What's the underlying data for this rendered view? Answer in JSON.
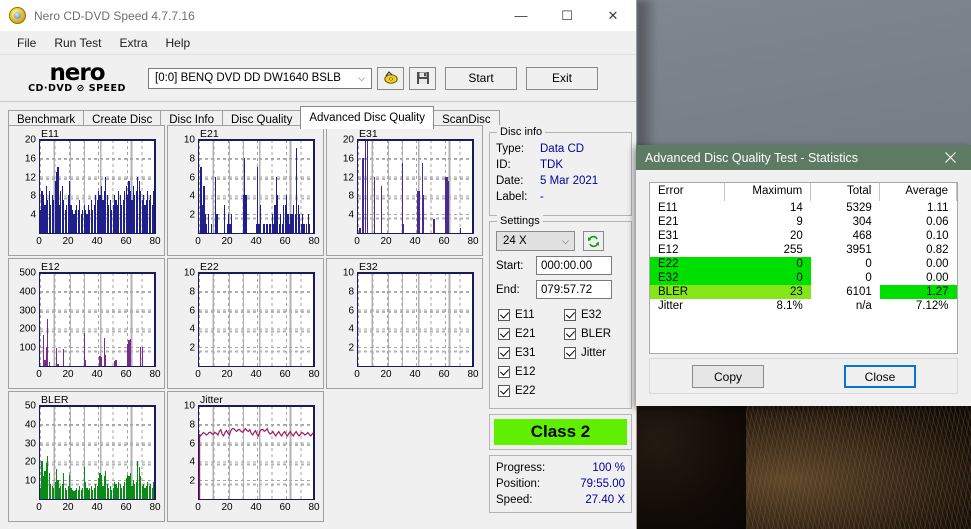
{
  "window": {
    "title": "Nero CD-DVD Speed 4.7.7.16",
    "icon": "nero-disc-icon",
    "controls": {
      "minimize": "—",
      "maximize": "☐",
      "close": "✕"
    }
  },
  "menu": {
    "items": [
      "File",
      "Run Test",
      "Extra",
      "Help"
    ]
  },
  "toolbar": {
    "logo_primary": "nero",
    "logo_secondary": "CD·DVD ⊘ SPEED",
    "drive_value": "[0:0]   BENQ DVD DD DW1640 BSLB",
    "drive_chevron": "⌵",
    "eject_icon": "disc-eject-icon",
    "save_icon": "floppy-save-icon",
    "start_label": "Start",
    "exit_label": "Exit"
  },
  "tabs": {
    "items": [
      "Benchmark",
      "Create Disc",
      "Disc Info",
      "Disc Quality",
      "Advanced Disc Quality",
      "ScanDisc"
    ],
    "active": "Advanced Disc Quality"
  },
  "disc_info": {
    "legend": "Disc info",
    "rows": [
      {
        "key": "Type:",
        "value": "Data CD"
      },
      {
        "key": "ID:",
        "value": "TDK"
      },
      {
        "key": "Date:",
        "value": "5 Mar 2021"
      },
      {
        "key": "Label:",
        "value": "-"
      }
    ]
  },
  "settings": {
    "legend": "Settings",
    "speed_value": "24 X",
    "speed_chevron": "⌵",
    "refresh_icon": "refresh-icon",
    "start_label": "Start:",
    "start_value": "000:00.00",
    "end_label": "End:",
    "end_value": "079:57.72",
    "checkboxes_left": [
      "E11",
      "E21",
      "E31",
      "E12",
      "E22"
    ],
    "checkboxes_right": [
      "E32",
      "BLER",
      "Jitter"
    ]
  },
  "class_badge": {
    "label": "Class 2",
    "color": "#5ef000"
  },
  "status": {
    "rows": [
      {
        "key": "Progress:",
        "value": "100 %"
      },
      {
        "key": "Position:",
        "value": "79:55.00"
      },
      {
        "key": "Speed:",
        "value": "27.40 X"
      }
    ]
  },
  "dialog": {
    "title": "Advanced Disc Quality Test - Statistics",
    "close_icon": "close-icon",
    "title_color": "#5d7a63",
    "headers": [
      "Error",
      "Maximum",
      "Total",
      "Average"
    ],
    "rows": [
      {
        "error": "E11",
        "maximum": "14",
        "total": "5329",
        "average": "1.11",
        "highlight": "none"
      },
      {
        "error": "E21",
        "maximum": "9",
        "total": "304",
        "average": "0.06",
        "highlight": "none"
      },
      {
        "error": "E31",
        "maximum": "20",
        "total": "468",
        "average": "0.10",
        "highlight": "none"
      },
      {
        "error": "E12",
        "maximum": "255",
        "total": "3951",
        "average": "0.82",
        "highlight": "none"
      },
      {
        "error": "E22",
        "maximum": "0",
        "total": "0",
        "average": "0.00",
        "highlight": "green-left"
      },
      {
        "error": "E32",
        "maximum": "0",
        "total": "0",
        "average": "0.00",
        "highlight": "green-left"
      },
      {
        "error": "BLER",
        "maximum": "23",
        "total": "6101",
        "average": "1.27",
        "highlight": "yellowgreen-left-green-avg"
      },
      {
        "error": "Jitter",
        "maximum": "8.1%",
        "total": "n/a",
        "average": "7.12%",
        "highlight": "none"
      }
    ],
    "highlight_colors": {
      "green": "#00e000",
      "yellow_green": "#84e619"
    },
    "copy_label": "Copy",
    "close_label": "Close"
  },
  "chart_data": [
    {
      "type": "bar",
      "title": "E11",
      "xlabel": "",
      "ylabel": "",
      "xlim": [
        0,
        80
      ],
      "ylim": [
        0,
        20
      ],
      "xticks": [
        0,
        20,
        40,
        60,
        80
      ],
      "yticks": [
        4,
        8,
        12,
        16,
        20
      ],
      "color": "#20208c",
      "grid": true,
      "x": [
        0,
        1,
        2,
        3,
        4,
        5,
        6,
        7,
        8,
        9,
        10,
        11,
        12,
        13,
        14,
        15,
        16,
        17,
        18,
        19,
        20,
        21,
        22,
        23,
        24,
        25,
        26,
        27,
        28,
        29,
        30,
        31,
        32,
        33,
        34,
        35,
        36,
        37,
        38,
        39,
        40,
        41,
        42,
        43,
        44,
        45,
        46,
        47,
        48,
        49,
        50,
        51,
        52,
        53,
        54,
        55,
        56,
        57,
        58,
        59,
        60,
        61,
        62,
        63,
        64,
        65,
        66,
        67,
        68,
        69,
        70,
        71,
        72,
        73,
        74,
        75,
        76,
        77,
        78,
        79
      ],
      "values": [
        5,
        9,
        8,
        6,
        10,
        7,
        9,
        6,
        8,
        7,
        11,
        13,
        14,
        6,
        9,
        10,
        7,
        5,
        6,
        8,
        11,
        6,
        5,
        4,
        5,
        6,
        5,
        7,
        4,
        5,
        6,
        5,
        4,
        6,
        5,
        7,
        5,
        6,
        8,
        7,
        9,
        8,
        10,
        7,
        9,
        12,
        8,
        6,
        7,
        5,
        6,
        8,
        7,
        6,
        9,
        8,
        6,
        7,
        9,
        10,
        8,
        11,
        9,
        7,
        10,
        8,
        9,
        12,
        11,
        9,
        7,
        8,
        6,
        7,
        9,
        7,
        8,
        6,
        9,
        7
      ]
    },
    {
      "type": "bar",
      "title": "E21",
      "xlabel": "",
      "ylabel": "",
      "xlim": [
        0,
        80
      ],
      "ylim": [
        0,
        10
      ],
      "xticks": [
        0,
        20,
        40,
        60,
        80
      ],
      "yticks": [
        2,
        4,
        6,
        8,
        10
      ],
      "color": "#20208c",
      "grid": true,
      "x": [
        0,
        1,
        2,
        3,
        4,
        5,
        6,
        7,
        8,
        9,
        10,
        11,
        12,
        13,
        14,
        15,
        16,
        17,
        18,
        19,
        20,
        21,
        22,
        23,
        24,
        25,
        26,
        27,
        28,
        29,
        30,
        31,
        32,
        33,
        34,
        35,
        36,
        37,
        38,
        39,
        40,
        41,
        42,
        43,
        44,
        45,
        46,
        47,
        48,
        49,
        50,
        51,
        52,
        53,
        54,
        55,
        56,
        57,
        58,
        59,
        60,
        61,
        62,
        63,
        64,
        65,
        66,
        67,
        68,
        69,
        70,
        71,
        72,
        73,
        74,
        75,
        76,
        77,
        78,
        79
      ],
      "values": [
        0,
        7,
        3,
        5,
        2,
        1,
        2,
        0,
        1,
        0,
        0,
        6,
        2,
        0,
        0,
        0,
        0,
        3,
        0,
        1,
        2,
        1,
        2,
        0,
        0,
        0,
        0,
        0,
        0,
        0,
        4,
        8,
        4,
        0,
        0,
        0,
        0,
        0,
        0,
        1,
        7,
        1,
        3,
        0,
        1,
        1,
        1,
        1,
        1,
        1,
        2,
        1,
        3,
        6,
        4,
        1,
        2,
        1,
        3,
        3,
        4,
        2,
        1,
        2,
        2,
        3,
        2,
        9,
        3,
        2,
        1,
        2,
        1,
        0,
        1,
        2,
        1,
        0,
        0,
        5
      ]
    },
    {
      "type": "bar",
      "title": "E31",
      "xlabel": "",
      "ylabel": "",
      "xlim": [
        0,
        80
      ],
      "ylim": [
        0,
        20
      ],
      "xticks": [
        0,
        20,
        40,
        60,
        80
      ],
      "yticks": [
        4,
        8,
        12,
        16,
        20
      ],
      "color": "#4a2a8e",
      "grid": true,
      "x": [
        0,
        1,
        2,
        3,
        4,
        5,
        6,
        7,
        8,
        9,
        10,
        11,
        12,
        13,
        14,
        15,
        16,
        17,
        18,
        19,
        20,
        21,
        22,
        23,
        24,
        25,
        26,
        27,
        28,
        29,
        30,
        31,
        32,
        33,
        34,
        35,
        36,
        37,
        38,
        39,
        40,
        41,
        42,
        43,
        44,
        45,
        46,
        47,
        48,
        49,
        50,
        51,
        52,
        53,
        54,
        55,
        56,
        57,
        58,
        59,
        60,
        61,
        62,
        63,
        64,
        65,
        66,
        67,
        68,
        69,
        70,
        71,
        72,
        73,
        74,
        75,
        76,
        77,
        78,
        79
      ],
      "values": [
        0,
        1,
        0,
        16,
        0,
        20,
        20,
        0,
        0,
        0,
        0,
        12,
        0,
        0,
        0,
        0,
        10,
        0,
        0,
        0,
        0,
        0,
        0,
        0,
        0,
        0,
        0,
        0,
        0,
        0,
        15,
        2,
        0,
        0,
        0,
        0,
        0,
        0,
        0,
        0,
        0,
        9,
        9,
        0,
        15,
        8,
        0,
        0,
        0,
        0,
        0,
        0,
        3,
        0,
        0,
        0,
        0,
        0,
        0,
        0,
        12,
        12,
        11,
        0,
        0,
        0,
        0,
        0,
        0,
        0,
        1,
        0,
        0,
        0,
        0,
        0,
        0,
        0,
        0,
        0
      ]
    },
    {
      "type": "bar",
      "title": "E12",
      "xlabel": "",
      "ylabel": "",
      "xlim": [
        0,
        80
      ],
      "ylim": [
        0,
        500
      ],
      "xticks": [
        0,
        20,
        40,
        60,
        80
      ],
      "yticks": [
        100,
        200,
        300,
        400,
        500
      ],
      "color": "#7b2a8e",
      "grid": true,
      "x": [
        0,
        1,
        2,
        3,
        4,
        5,
        6,
        7,
        8,
        9,
        10,
        11,
        12,
        13,
        14,
        15,
        16,
        17,
        18,
        19,
        20,
        21,
        22,
        23,
        24,
        25,
        26,
        27,
        28,
        29,
        30,
        31,
        32,
        33,
        34,
        35,
        36,
        37,
        38,
        39,
        40,
        41,
        42,
        43,
        44,
        45,
        46,
        47,
        48,
        49,
        50,
        51,
        52,
        53,
        54,
        55,
        56,
        57,
        58,
        59,
        60,
        61,
        62,
        63,
        64,
        65,
        66,
        67,
        68,
        69,
        70,
        71,
        72,
        73,
        74,
        75,
        76,
        77,
        78,
        79
      ],
      "values": [
        0,
        0,
        165,
        30,
        100,
        250,
        20,
        0,
        0,
        0,
        0,
        95,
        10,
        0,
        0,
        0,
        90,
        0,
        0,
        0,
        0,
        0,
        0,
        0,
        0,
        0,
        0,
        0,
        0,
        0,
        175,
        30,
        0,
        0,
        0,
        0,
        0,
        0,
        0,
        0,
        0,
        55,
        50,
        0,
        150,
        60,
        0,
        0,
        0,
        0,
        0,
        25,
        30,
        0,
        0,
        0,
        0,
        0,
        0,
        0,
        115,
        140,
        145,
        0,
        0,
        0,
        0,
        0,
        0,
        100,
        100,
        0,
        0,
        0,
        0,
        0,
        0,
        0,
        0,
        0
      ]
    },
    {
      "type": "bar",
      "title": "E22",
      "xlabel": "",
      "ylabel": "",
      "xlim": [
        0,
        80
      ],
      "ylim": [
        0,
        10
      ],
      "xticks": [
        0,
        20,
        40,
        60,
        80
      ],
      "yticks": [
        2,
        4,
        6,
        8,
        10
      ],
      "color": "#20208c",
      "grid": true,
      "x": [],
      "values": []
    },
    {
      "type": "bar",
      "title": "E32",
      "xlabel": "",
      "ylabel": "",
      "xlim": [
        0,
        80
      ],
      "ylim": [
        0,
        10
      ],
      "xticks": [
        0,
        20,
        40,
        60,
        80
      ],
      "yticks": [
        2,
        4,
        6,
        8,
        10
      ],
      "color": "#20208c",
      "grid": true,
      "x": [],
      "values": []
    },
    {
      "type": "bar",
      "title": "BLER",
      "xlabel": "",
      "ylabel": "",
      "xlim": [
        0,
        80
      ],
      "ylim": [
        0,
        50
      ],
      "xticks": [
        0,
        20,
        40,
        60,
        80
      ],
      "yticks": [
        10,
        20,
        30,
        40,
        50
      ],
      "color": "#0a8a16",
      "grid": true,
      "x": [
        0,
        1,
        2,
        3,
        4,
        5,
        6,
        7,
        8,
        9,
        10,
        11,
        12,
        13,
        14,
        15,
        16,
        17,
        18,
        19,
        20,
        21,
        22,
        23,
        24,
        25,
        26,
        27,
        28,
        29,
        30,
        31,
        32,
        33,
        34,
        35,
        36,
        37,
        38,
        39,
        40,
        41,
        42,
        43,
        44,
        45,
        46,
        47,
        48,
        49,
        50,
        51,
        52,
        53,
        54,
        55,
        56,
        57,
        58,
        59,
        60,
        61,
        62,
        63,
        64,
        65,
        66,
        67,
        68,
        69,
        70,
        71,
        72,
        73,
        74,
        75,
        76,
        77,
        78,
        79
      ],
      "values": [
        6,
        20,
        12,
        15,
        19,
        23,
        14,
        8,
        7,
        6,
        9,
        16,
        10,
        6,
        7,
        8,
        14,
        6,
        5,
        7,
        13,
        6,
        5,
        4,
        5,
        6,
        5,
        7,
        5,
        6,
        17,
        9,
        6,
        5,
        6,
        7,
        5,
        6,
        8,
        7,
        11,
        14,
        13,
        7,
        12,
        15,
        8,
        6,
        7,
        5,
        6,
        9,
        8,
        6,
        9,
        8,
        6,
        7,
        9,
        11,
        13,
        12,
        14,
        7,
        10,
        8,
        9,
        20,
        17,
        12,
        7,
        8,
        6,
        7,
        9,
        7,
        8,
        6,
        9,
        7
      ]
    },
    {
      "type": "line",
      "title": "Jitter",
      "xlabel": "",
      "ylabel": "",
      "xlim": [
        0,
        80
      ],
      "ylim": [
        0,
        10
      ],
      "xticks": [
        0,
        20,
        40,
        60,
        80
      ],
      "yticks": [
        2,
        4,
        6,
        8,
        10
      ],
      "color": "#9b1b5c",
      "grid": true,
      "x": [
        0,
        2,
        4,
        6,
        8,
        10,
        12,
        14,
        16,
        18,
        20,
        22,
        24,
        26,
        28,
        30,
        32,
        34,
        36,
        38,
        40,
        42,
        44,
        46,
        48,
        50,
        52,
        54,
        56,
        58,
        60,
        62,
        64,
        66,
        68,
        70,
        72,
        74,
        76,
        78,
        80
      ],
      "values": [
        7.0,
        7.0,
        7.1,
        7.0,
        7.2,
        7.0,
        7.1,
        7.3,
        7.0,
        7.2,
        7.1,
        7.4,
        7.6,
        7.3,
        7.5,
        7.2,
        7.6,
        7.3,
        7.1,
        7.2,
        7.0,
        7.3,
        7.5,
        7.4,
        7.2,
        7.1,
        7.0,
        7.1,
        7.0,
        7.1,
        7.0,
        7.1,
        7.0,
        7.1,
        7.0,
        7.0,
        7.1,
        7.0,
        7.0,
        7.0,
        7.0
      ]
    }
  ]
}
